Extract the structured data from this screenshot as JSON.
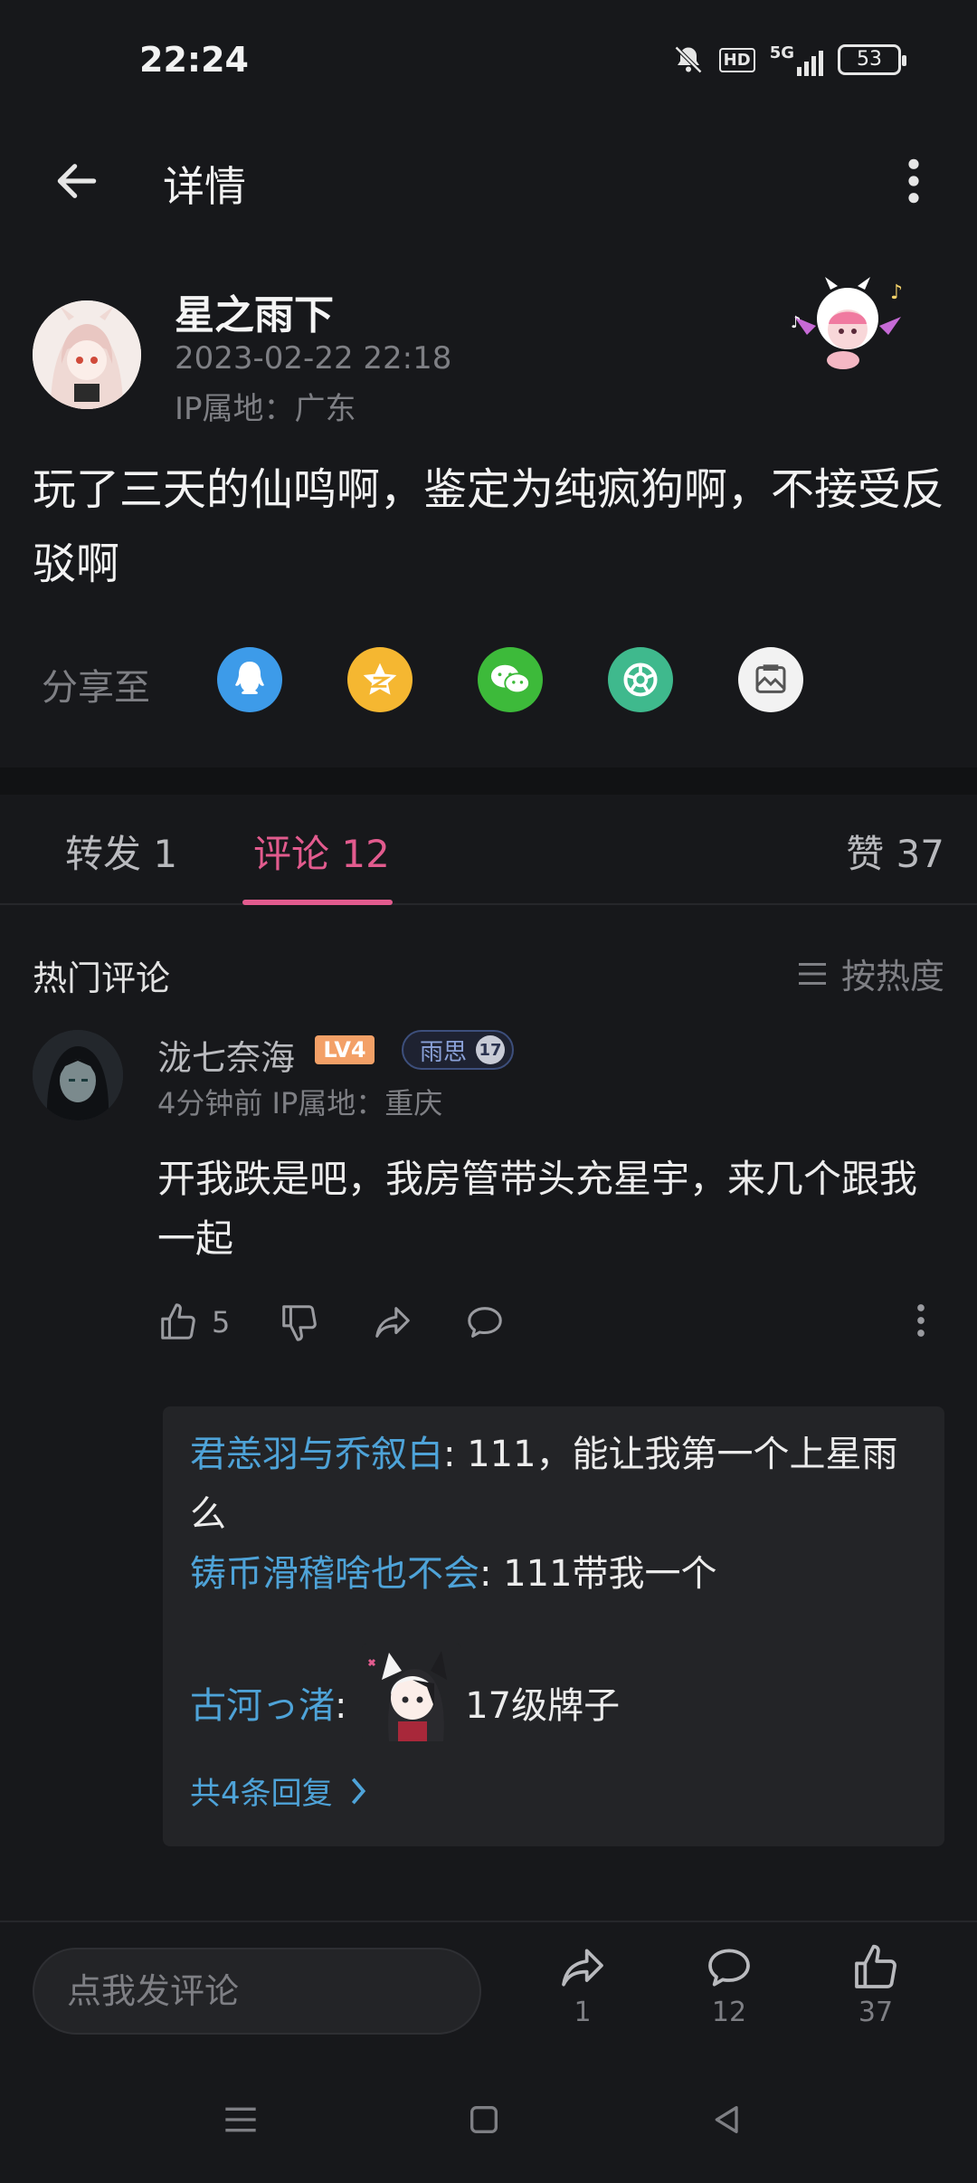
{
  "status_bar": {
    "time": "22:24",
    "network": "5G",
    "hd_label": "HD",
    "battery": "53",
    "icons": [
      "bell-off-icon",
      "hd-icon",
      "signal-5g-icon",
      "battery-icon"
    ]
  },
  "app_bar": {
    "title": "详情",
    "back_icon": "arrow-left-icon",
    "more_icon": "more-vertical-icon"
  },
  "post": {
    "author": "星之雨下",
    "time": "2023-02-22 22:18",
    "ip": "IP属地：广东",
    "body": "玩了三天的仙鸣啊，鉴定为纯疯狗啊，不接受反驳啊"
  },
  "share": {
    "label": "分享至",
    "targets": [
      {
        "name": "qq",
        "icon": "qq-icon",
        "color": "#3d9be9"
      },
      {
        "name": "qzone",
        "icon": "star-icon",
        "color": "#f5b731"
      },
      {
        "name": "wechat",
        "icon": "wechat-icon",
        "color": "#3dba3a"
      },
      {
        "name": "moments",
        "icon": "shutter-icon",
        "color": "#3fb98d"
      },
      {
        "name": "image",
        "icon": "image-icon",
        "color": "#f2f2f2"
      }
    ]
  },
  "tabs": {
    "repost": "转发 1",
    "comment": "评论 12",
    "like": "赞 37",
    "active": "comment",
    "accent": "#e25b8e"
  },
  "hot_comments": {
    "title": "热门评论",
    "sort_label": "按热度"
  },
  "comment": {
    "user": "泷七奈海",
    "level": "LV4",
    "medal_name": "雨思",
    "medal_level": "17",
    "meta": "4分钟前  IP属地：重庆",
    "text": "开我跌是吧，我房管带头充星宇，来几个跟我一起",
    "like_count": "5"
  },
  "replies": {
    "items": [
      {
        "user": "君恙羽与乔叙白",
        "sep": ": ",
        "text": "111，能让我第一个上星雨么"
      },
      {
        "user": "铸币滑稽啥也不会",
        "sep": ": ",
        "text": "111带我一个"
      },
      {
        "user": "古河っ渚",
        "sep": ": ",
        "text": "17级牌子"
      }
    ],
    "more_label": "共4条回复",
    "link_color": "#4ea3d8"
  },
  "bottom_bar": {
    "input_placeholder": "点我发评论",
    "repost_count": "1",
    "comment_count": "12",
    "like_count": "37"
  }
}
